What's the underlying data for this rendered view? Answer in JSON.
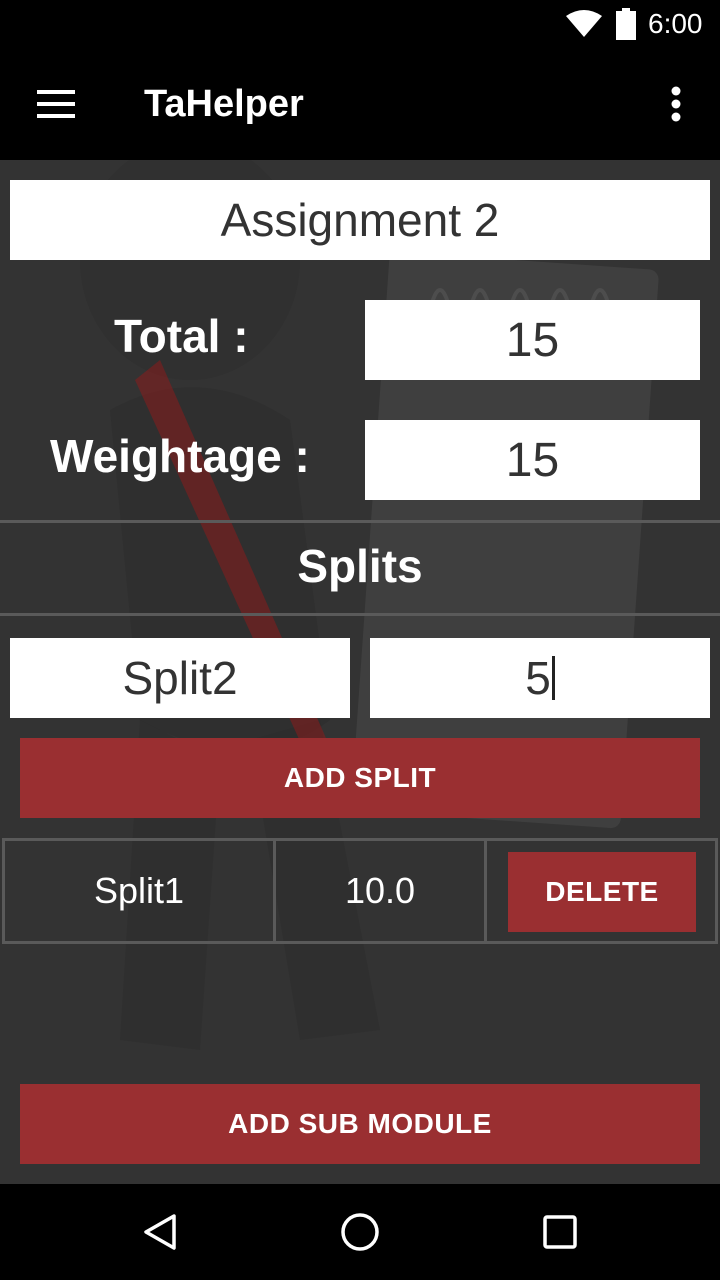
{
  "status_bar": {
    "time": "6:00",
    "icons": [
      "wifi-icon",
      "battery-icon"
    ]
  },
  "app_bar": {
    "title": "TaHelper",
    "menu_icon": "hamburger-menu-icon",
    "overflow_icon": "more-vert-icon"
  },
  "assignment": {
    "name": "Assignment 2",
    "total_label": "Total :",
    "total_value": "15",
    "weightage_label": "Weightage :",
    "weightage_value": "15"
  },
  "splits": {
    "heading": "Splits",
    "new_split_name": "Split2",
    "new_split_value": "5",
    "add_split_label": "ADD SPLIT",
    "list": [
      {
        "name": "Split1",
        "value": "10.0",
        "delete_label": "DELETE"
      }
    ]
  },
  "add_sub_module_label": "ADD SUB MODULE",
  "nav_bar": {
    "icons": [
      "back-icon",
      "home-icon",
      "recents-icon"
    ]
  },
  "colors": {
    "accent_red": "#9a2f31",
    "background": "#333333",
    "bar": "#000000"
  }
}
